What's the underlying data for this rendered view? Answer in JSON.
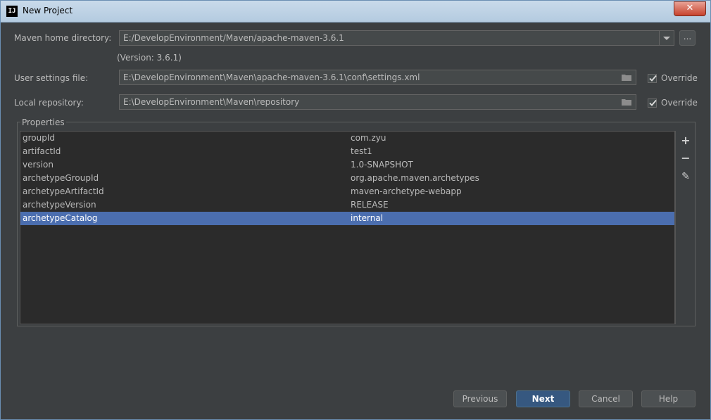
{
  "window": {
    "title": "New Project",
    "close_label": "✕"
  },
  "maven_home": {
    "label": "Maven home directory:",
    "value": "E:/DevelopEnvironment/Maven/apache-maven-3.6.1",
    "version_text": "(Version: 3.6.1)",
    "browse_label": "..."
  },
  "user_settings": {
    "label": "User settings file:",
    "value": "E:\\DevelopEnvironment\\Maven\\apache-maven-3.6.1\\conf\\settings.xml",
    "override_label": "Override",
    "override_checked": true
  },
  "local_repo": {
    "label": "Local repository:",
    "value": "E:\\DevelopEnvironment\\Maven\\repository",
    "override_label": "Override",
    "override_checked": true
  },
  "properties": {
    "title": "Properties",
    "rows": [
      {
        "key": "groupId",
        "value": "com.zyu"
      },
      {
        "key": "artifactId",
        "value": "test1"
      },
      {
        "key": "version",
        "value": "1.0-SNAPSHOT"
      },
      {
        "key": "archetypeGroupId",
        "value": "org.apache.maven.archetypes"
      },
      {
        "key": "archetypeArtifactId",
        "value": "maven-archetype-webapp"
      },
      {
        "key": "archetypeVersion",
        "value": "RELEASE"
      },
      {
        "key": "archetypeCatalog",
        "value": "internal"
      }
    ],
    "selected_index": 6,
    "toolbar": {
      "add": "+",
      "remove": "−",
      "edit": "✎"
    }
  },
  "buttons": {
    "previous": "Previous",
    "next": "Next",
    "cancel": "Cancel",
    "help": "Help"
  },
  "colors": {
    "selection": "#4b6eaf",
    "primary_button": "#365880"
  }
}
